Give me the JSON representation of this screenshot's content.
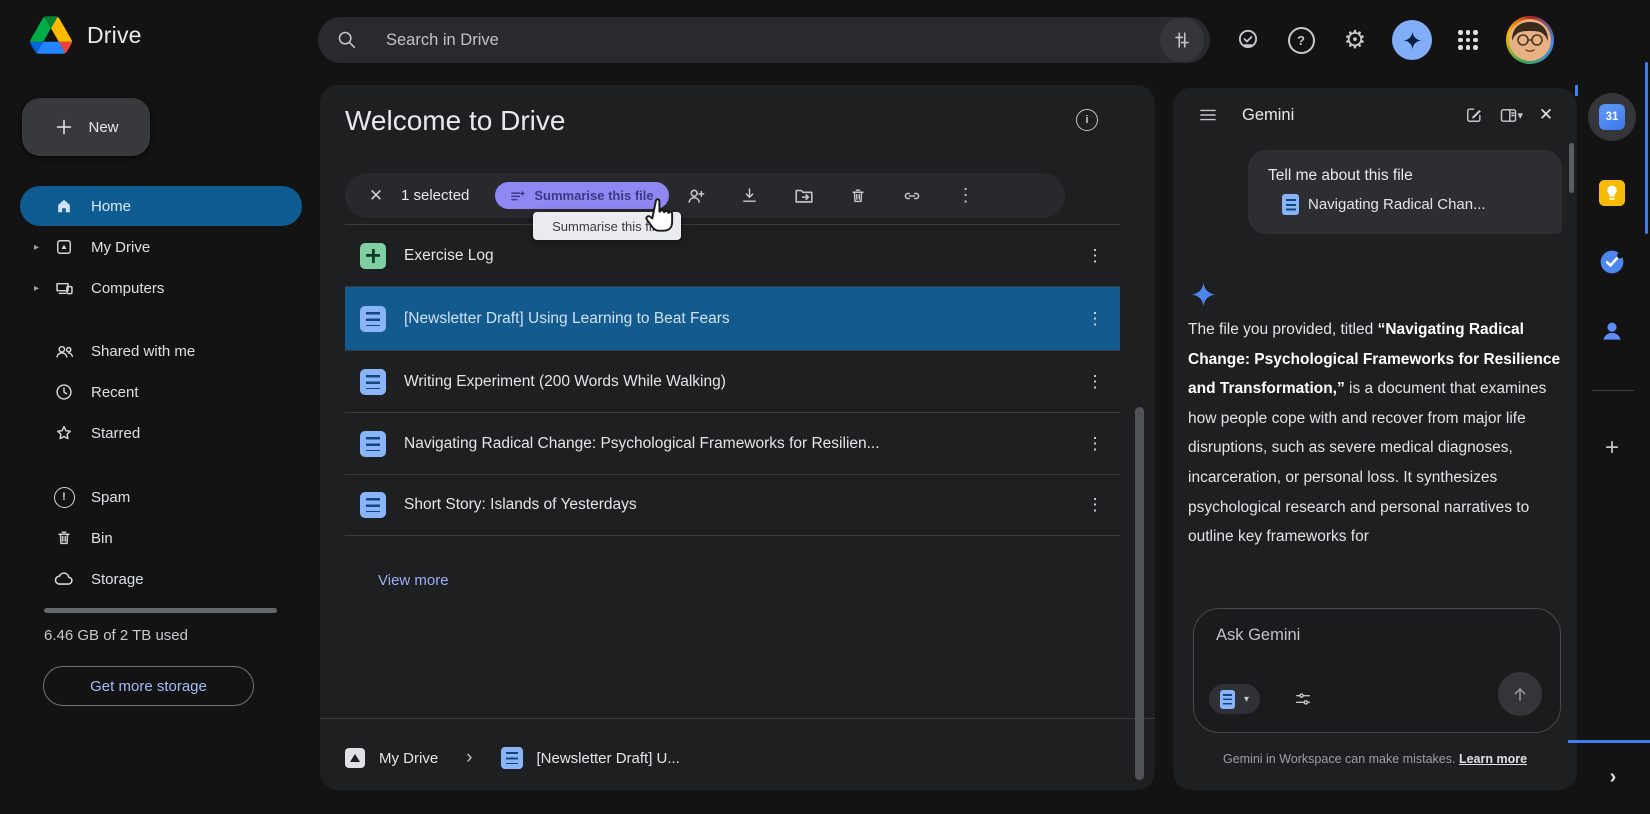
{
  "topbar": {
    "app_name": "Drive",
    "search_placeholder": "Search in Drive"
  },
  "sidebar": {
    "new_label": "New",
    "items": [
      {
        "label": "Home",
        "active": true
      },
      {
        "label": "My Drive",
        "expandable": true
      },
      {
        "label": "Computers",
        "expandable": true
      },
      {
        "label": "Shared with me"
      },
      {
        "label": "Recent"
      },
      {
        "label": "Starred"
      },
      {
        "label": "Spam"
      },
      {
        "label": "Bin"
      },
      {
        "label": "Storage"
      }
    ],
    "storage_summary": "6.46 GB of 2 TB used",
    "get_more_storage_label": "Get more storage"
  },
  "main": {
    "title": "Welcome to Drive",
    "toolbar": {
      "selected_label": "1 selected",
      "summarise_label": "Summarise this file",
      "tooltip": "Summarise this file"
    },
    "files": [
      {
        "name": "Exercise Log",
        "type": "sheet"
      },
      {
        "name": "[Newsletter Draft] Using Learning to Beat Fears",
        "type": "doc",
        "selected": true
      },
      {
        "name": "Writing Experiment (200 Words While Walking)",
        "type": "doc"
      },
      {
        "name": "Navigating Radical Change: Psychological Frameworks for Resilien...",
        "type": "doc"
      },
      {
        "name": "Short Story: Islands of Yesterdays",
        "type": "doc"
      }
    ],
    "view_more_label": "View more",
    "breadcrumb": {
      "root": "My Drive",
      "current": "[Newsletter Draft] U..."
    }
  },
  "gemini": {
    "header_title": "Gemini",
    "user_prompt": "Tell me about this file",
    "prompt_file_name": "Navigating Radical Chan...",
    "response": {
      "part1": "The file you provided, titled ",
      "bold": "“Navigating Radical Change: Psychological Frameworks for Resilience and Transformation,”",
      "part2": " is a document that examines how people cope with and recover from major life disruptions, such as severe medical diagnoses, incarceration, or personal loss. It synthesizes psychological research and personal narratives to outline key frameworks for"
    },
    "ask_placeholder": "Ask Gemini",
    "disclaimer": "Gemini in Workspace can make mistakes. ",
    "learn_more_label": "Learn more"
  },
  "workspace_rail": {
    "calendar_day": "31"
  },
  "glyphs": {
    "close": "✕",
    "more_vert": "⋮",
    "caret_right": "▸",
    "dropdown_caret": "▾",
    "chevron_right": "›",
    "plus": "+",
    "gear": "⚙",
    "help": "?",
    "exclaim": "!",
    "info": "i"
  },
  "colors": {
    "selection_blue": "#135a8e",
    "active_nav_blue": "#0f5c92",
    "summarise_pill_purple": "#8f88f2",
    "link_blue": "#9ab0f3",
    "gemini_sparkle_blue": "#4e86ee",
    "surface": "#1e1f20",
    "background": "#131314"
  }
}
